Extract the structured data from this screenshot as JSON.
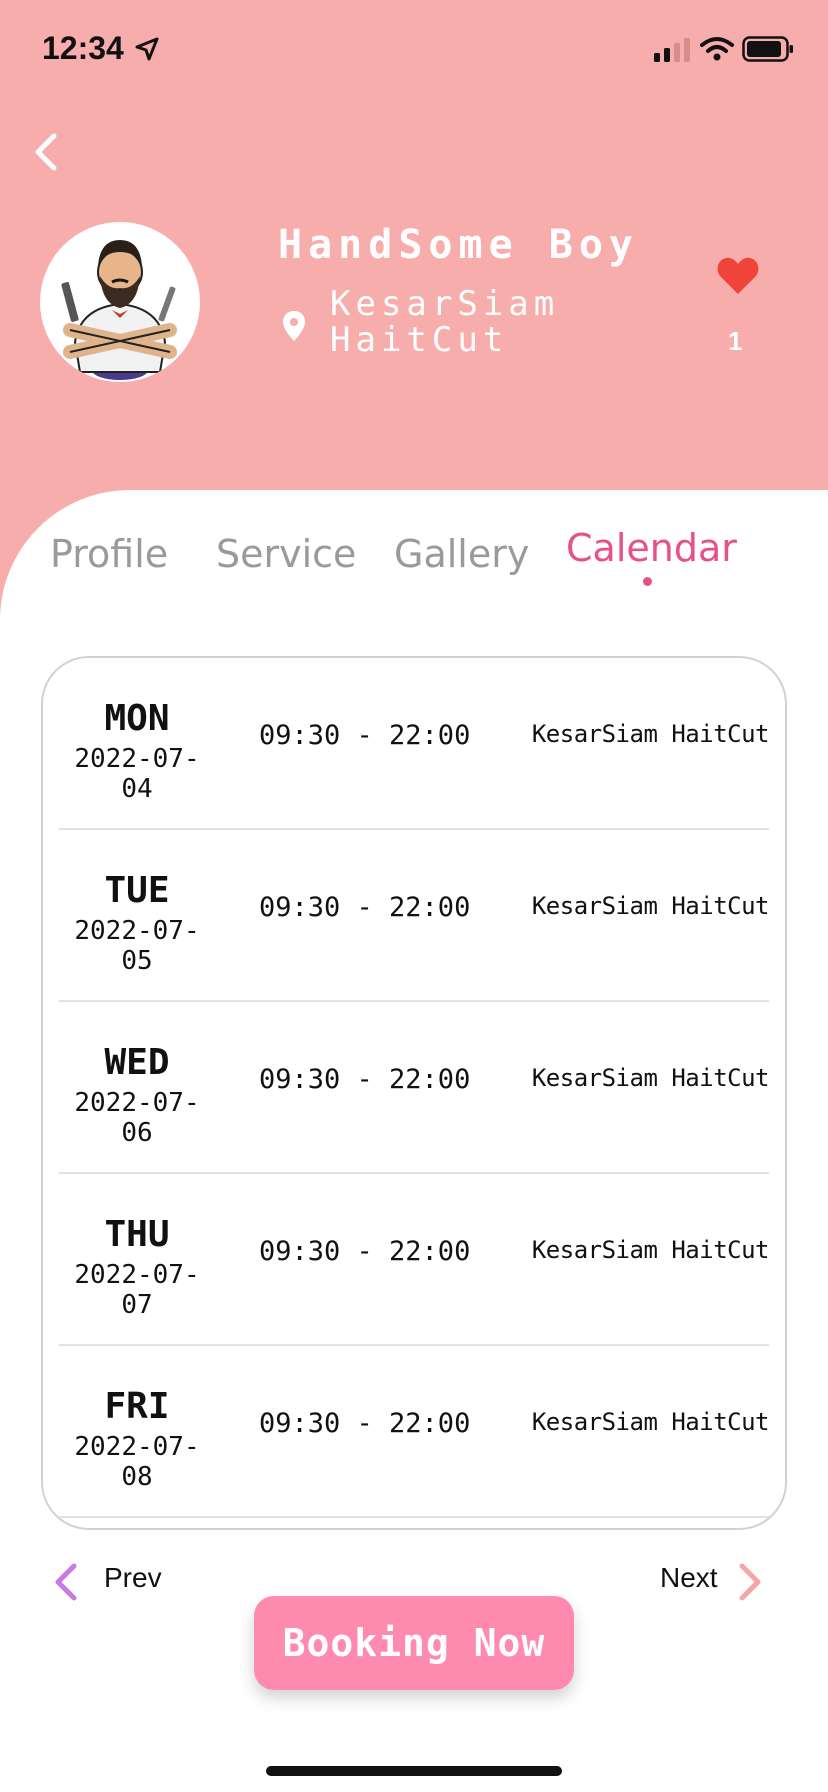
{
  "status_bar": {
    "time": "12:34"
  },
  "colors": {
    "header_bg": "#f8adad",
    "accent_pink": "#e8508a",
    "button_pink": "#ff8aaf",
    "heart_red": "#f0443a",
    "prev_chevron": "#c77be0",
    "next_chevron": "#f5a6a6"
  },
  "icons": {
    "back": "chevron-left-icon",
    "location": "location-pin-icon",
    "favorite": "heart-icon",
    "prev": "chevron-left-icon",
    "next": "chevron-right-icon"
  },
  "shop": {
    "name": "HandSome Boy",
    "location": "KesarSiam HaitCut",
    "likes": "1"
  },
  "tabs": [
    {
      "label": "Profile"
    },
    {
      "label": "Service"
    },
    {
      "label": "Gallery"
    },
    {
      "label": "Calendar"
    }
  ],
  "active_tab": "Calendar",
  "schedule": [
    {
      "day": "MON",
      "date": "2022-07-04",
      "hours": "09:30 - 22:00",
      "place": "KesarSiam HaitCut"
    },
    {
      "day": "TUE",
      "date": "2022-07-05",
      "hours": "09:30 - 22:00",
      "place": "KesarSiam HaitCut"
    },
    {
      "day": "WED",
      "date": "2022-07-06",
      "hours": "09:30 - 22:00",
      "place": "KesarSiam HaitCut"
    },
    {
      "day": "THU",
      "date": "2022-07-07",
      "hours": "09:30 - 22:00",
      "place": "KesarSiam HaitCut"
    },
    {
      "day": "FRI",
      "date": "2022-07-08",
      "hours": "09:30 - 22:00",
      "place": "KesarSiam HaitCut"
    }
  ],
  "pagination": {
    "prev_label": "Prev",
    "next_label": "Next"
  },
  "booking_button": "Booking Now"
}
